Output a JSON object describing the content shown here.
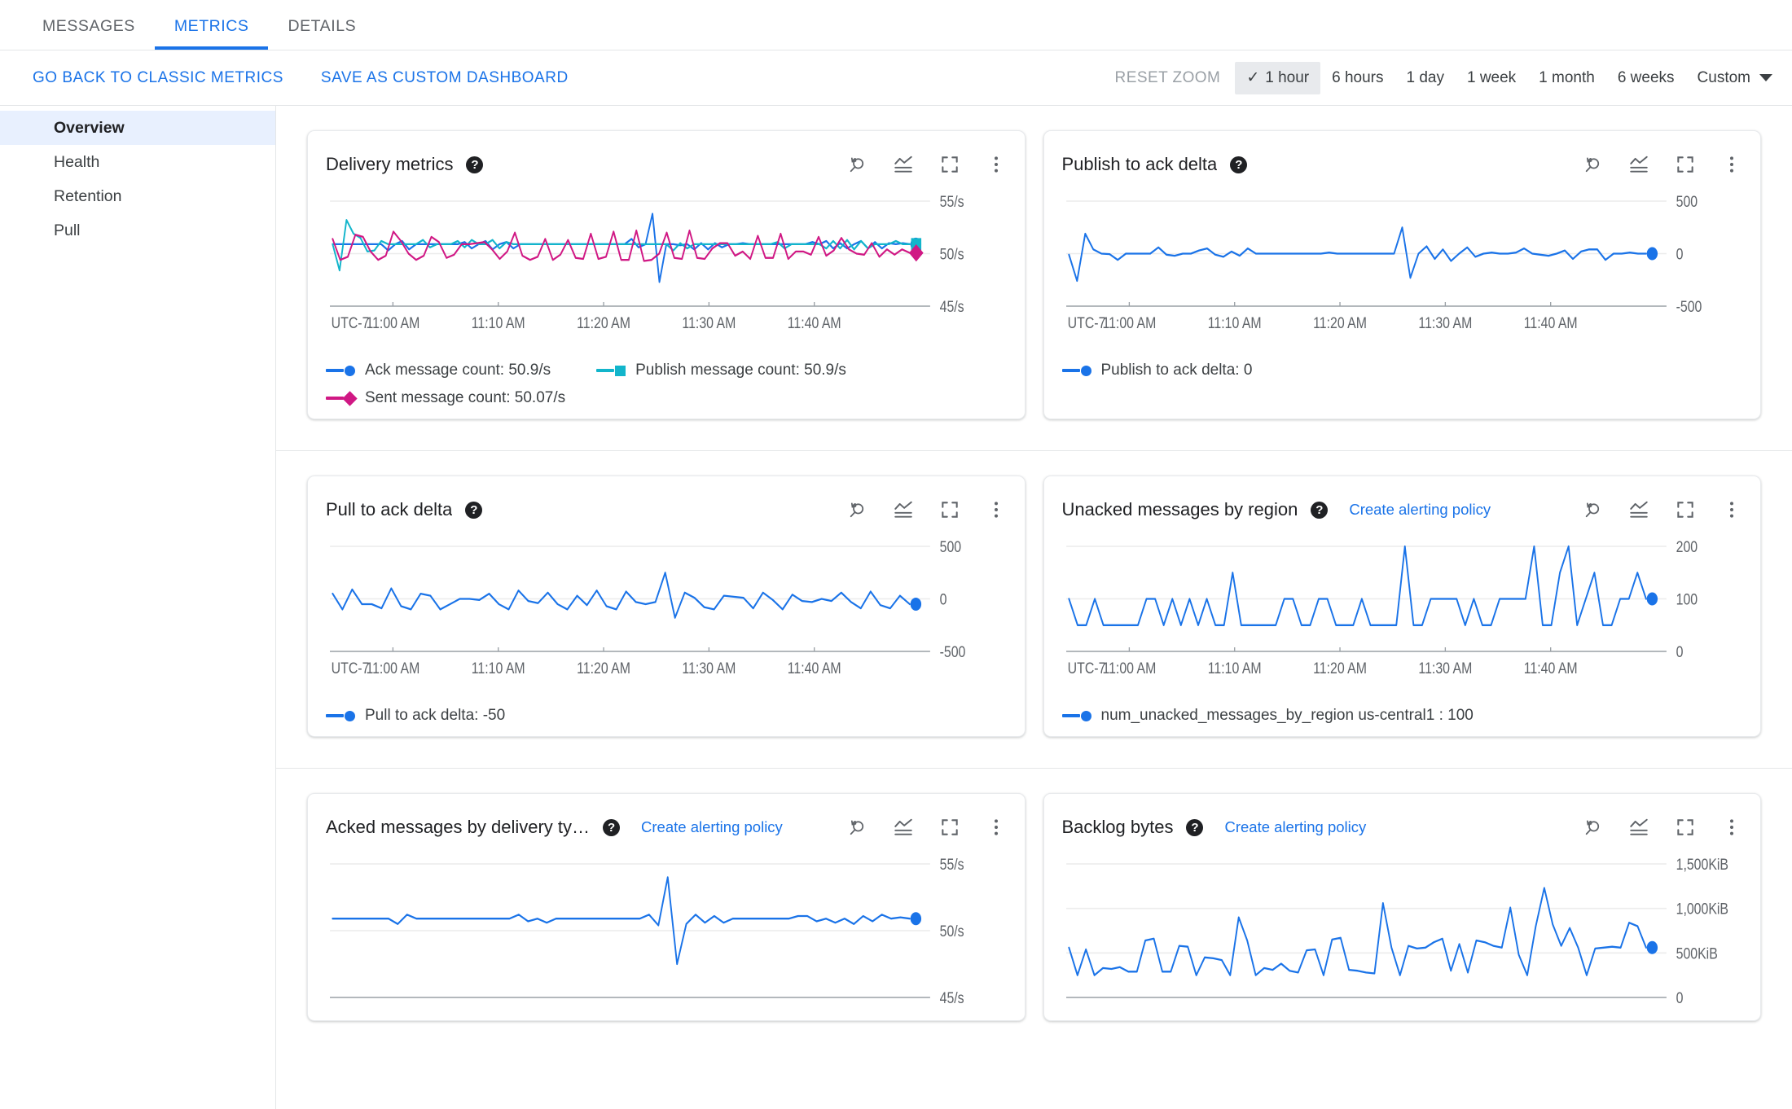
{
  "tabs": [
    {
      "label": "MESSAGES",
      "active": false
    },
    {
      "label": "METRICS",
      "active": true
    },
    {
      "label": "DETAILS",
      "active": false
    }
  ],
  "actionbar": {
    "go_back_label": "GO BACK TO CLASSIC METRICS",
    "save_dashboard_label": "SAVE AS CUSTOM DASHBOARD",
    "reset_zoom_label": "RESET ZOOM",
    "check_glyph": "✓",
    "ranges": [
      {
        "label": "1 hour",
        "selected": true
      },
      {
        "label": "6 hours",
        "selected": false
      },
      {
        "label": "1 day",
        "selected": false
      },
      {
        "label": "1 week",
        "selected": false
      },
      {
        "label": "1 month",
        "selected": false
      },
      {
        "label": "6 weeks",
        "selected": false
      },
      {
        "label": "Custom",
        "selected": false
      }
    ]
  },
  "sidebar": {
    "items": [
      {
        "label": "Overview",
        "active": true
      },
      {
        "label": "Health",
        "active": false
      },
      {
        "label": "Retention",
        "active": false
      },
      {
        "label": "Pull",
        "active": false
      }
    ]
  },
  "colors": {
    "blue": "#1a73e8",
    "teal": "#12b5cb",
    "pink": "#d01884",
    "accent_link": "#1a73e8",
    "axis_text": "#5f6368",
    "gridline": "#ececec",
    "selected_nav_bg": "#e8f0fe"
  },
  "icons": {
    "help": "?",
    "reset_zoom": "reset-zoom-icon",
    "chart_legend": "chart-lines-icon",
    "fullscreen": "fullscreen-icon",
    "more": "more-vert-icon"
  },
  "chart_data": [
    {
      "id": "delivery-metrics",
      "type": "line",
      "title": "Delivery metrics",
      "has_alert_link": false,
      "xlabel": "",
      "ylabel": "",
      "timezone_label": "UTC-7",
      "xtick_labels": [
        "11:00 AM",
        "11:10 AM",
        "11:20 AM",
        "11:30 AM",
        "11:40 AM"
      ],
      "ytick_labels": [
        "55/s",
        "50/s",
        "45/s"
      ],
      "ylim": [
        45,
        55
      ],
      "grid": true,
      "legend_position": "bottom",
      "series": [
        {
          "name": "Ack message count",
          "value_label": "Ack message count:  50.9/s",
          "color": "#1a73e8",
          "marker": "circle",
          "values": [
            50.9,
            50.9,
            50.9,
            50.9,
            50.9,
            50.9,
            50.9,
            50.9,
            50.3,
            50.9,
            51.2,
            50.4,
            50.9,
            50.9,
            50.9,
            50.9,
            50.9,
            50.9,
            50.9,
            51.1,
            50.5,
            50.9,
            51.2,
            50.4,
            50.9,
            51.1,
            50.5,
            50.9,
            50.9,
            50.9,
            50.9,
            50.9,
            50.9,
            50.9,
            50.9,
            50.9,
            50.9,
            50.9,
            50.9,
            50.9,
            50.9,
            50.9,
            50.9,
            51.4,
            50.6,
            50.9,
            53.8,
            47.3,
            50.9,
            50.9,
            50.8,
            50.9,
            50.4,
            51.0,
            50.4,
            51.0,
            50.6,
            50.9,
            50.9,
            51.0,
            50.9,
            50.9,
            50.9,
            50.9,
            50.9,
            50.9,
            50.9,
            50.9,
            50.9,
            51.1,
            50.9,
            51.2,
            50.5,
            51.0,
            50.5,
            50.9,
            51.2,
            50.5,
            51.1,
            50.5,
            51.0,
            50.9,
            51.0,
            50.9
          ]
        },
        {
          "name": "Publish message count",
          "value_label": "Publish message count:  50.9/s",
          "color": "#12b5cb",
          "marker": "square",
          "values": [
            50.9,
            48.4,
            53.2,
            51.9,
            51.5,
            50.2,
            50.3,
            51.2,
            50.9,
            50.9,
            50.9,
            50.9,
            50.9,
            51.3,
            50.6,
            50.9,
            50.9,
            50.9,
            51.2,
            50.6,
            51.3,
            50.9,
            50.9,
            51.3,
            50.5,
            51.1,
            50.9,
            50.9,
            50.9,
            50.9,
            50.9,
            50.9,
            50.9,
            50.9,
            50.9,
            50.9,
            50.9,
            50.9,
            50.9,
            50.9,
            50.9,
            50.9,
            50.9,
            50.9,
            50.9,
            50.9,
            50.9,
            50.9,
            50.9,
            50.3,
            51.0,
            50.5,
            50.9,
            50.9,
            50.9,
            50.9,
            50.9,
            50.9,
            50.9,
            50.9,
            50.9,
            50.9,
            50.9,
            50.9,
            51.1,
            50.5,
            50.9,
            50.9,
            50.9,
            50.9,
            50.9,
            50.5,
            51.2,
            50.5,
            51.3,
            50.4,
            51.2,
            50.5,
            50.9,
            50.9,
            50.9,
            51.2,
            50.9,
            50.9
          ]
        },
        {
          "name": "Sent message count",
          "value_label": "Sent message count:  50.07/s",
          "color": "#d01884",
          "marker": "diamond",
          "values": [
            51.4,
            49.4,
            49.7,
            51.8,
            51.6,
            50.2,
            49.4,
            49.8,
            52.1,
            51.2,
            50.0,
            49.4,
            49.8,
            51.6,
            51.1,
            49.6,
            49.9,
            50.9,
            50.9,
            51.0,
            51.1,
            50.4,
            49.5,
            50.2,
            52.0,
            49.8,
            49.4,
            49.7,
            51.4,
            49.4,
            49.9,
            51.3,
            49.6,
            49.5,
            51.9,
            49.5,
            49.7,
            52.1,
            49.4,
            49.4,
            52.2,
            49.3,
            49.4,
            50.0,
            52.0,
            49.6,
            49.5,
            52.2,
            49.6,
            49.5,
            50.5,
            51.0,
            51.0,
            49.8,
            50.2,
            49.5,
            51.7,
            49.6,
            49.6,
            51.9,
            49.5,
            50.2,
            50.2,
            49.9,
            51.6,
            49.8,
            50.3,
            51.5,
            50.4,
            50.0,
            49.9,
            51.0,
            49.7,
            50.4,
            49.9,
            50.4,
            50.07
          ]
        }
      ]
    },
    {
      "id": "publish-to-ack-delta",
      "type": "line",
      "title": "Publish to ack delta",
      "has_alert_link": false,
      "timezone_label": "UTC-7",
      "xtick_labels": [
        "11:00 AM",
        "11:10 AM",
        "11:20 AM",
        "11:30 AM",
        "11:40 AM"
      ],
      "ytick_labels": [
        "500",
        "0",
        "-500"
      ],
      "ylim": [
        -500,
        500
      ],
      "grid": true,
      "legend_position": "bottom",
      "series": [
        {
          "name": "Publish to ack delta",
          "value_label": "Publish to ack delta: 0",
          "color": "#1a73e8",
          "marker": "circle",
          "values": [
            -10,
            -260,
            190,
            40,
            0,
            -5,
            -60,
            0,
            0,
            0,
            0,
            60,
            -10,
            -20,
            0,
            0,
            30,
            50,
            -10,
            -30,
            20,
            -20,
            50,
            0,
            0,
            0,
            0,
            0,
            0,
            0,
            0,
            0,
            10,
            0,
            0,
            0,
            0,
            0,
            0,
            0,
            0,
            250,
            -230,
            0,
            70,
            -50,
            40,
            -70,
            0,
            60,
            -30,
            0,
            10,
            0,
            0,
            10,
            50,
            0,
            -10,
            -20,
            0,
            30,
            -50,
            20,
            40,
            40,
            -60,
            0,
            0,
            10,
            0,
            0
          ]
        }
      ]
    },
    {
      "id": "pull-to-ack-delta",
      "type": "line",
      "title": "Pull to ack delta",
      "has_alert_link": false,
      "timezone_label": "UTC-7",
      "xtick_labels": [
        "11:00 AM",
        "11:10 AM",
        "11:20 AM",
        "11:30 AM",
        "11:40 AM"
      ],
      "ytick_labels": [
        "500",
        "0",
        "-500"
      ],
      "ylim": [
        -500,
        500
      ],
      "grid": true,
      "legend_position": "bottom",
      "series": [
        {
          "name": "Pull to ack delta",
          "value_label": "Pull to ack delta: -50",
          "color": "#1a73e8",
          "marker": "circle",
          "values": [
            50,
            -100,
            90,
            -50,
            -50,
            -90,
            100,
            -70,
            -100,
            50,
            30,
            -100,
            -50,
            0,
            0,
            -10,
            50,
            -50,
            -100,
            80,
            -20,
            -40,
            60,
            -50,
            -100,
            30,
            -60,
            80,
            -70,
            -100,
            70,
            -30,
            -50,
            -30,
            250,
            -180,
            60,
            10,
            -80,
            -100,
            30,
            20,
            10,
            -90,
            60,
            -10,
            -100,
            40,
            -20,
            -30,
            0,
            -20,
            60,
            -30,
            -90,
            70,
            -60,
            -90,
            30,
            -50
          ]
        }
      ]
    },
    {
      "id": "unacked-messages-by-region",
      "type": "line",
      "title": "Unacked messages by region",
      "has_alert_link": true,
      "alert_link_label": "Create alerting policy",
      "timezone_label": "UTC-7",
      "xtick_labels": [
        "11:00 AM",
        "11:10 AM",
        "11:20 AM",
        "11:30 AM",
        "11:40 AM"
      ],
      "ytick_labels": [
        "200",
        "100",
        "0"
      ],
      "ylim": [
        0,
        200
      ],
      "grid": true,
      "legend_position": "bottom",
      "series": [
        {
          "name": "num_unacked_messages_by_region us-central1",
          "value_label": "num_unacked_messages_by_region us-central1 :  100",
          "color": "#1a73e8",
          "marker": "circle",
          "values": [
            100,
            50,
            50,
            100,
            50,
            50,
            50,
            50,
            50,
            100,
            100,
            50,
            100,
            50,
            100,
            50,
            100,
            50,
            50,
            150,
            50,
            50,
            50,
            50,
            50,
            100,
            100,
            50,
            50,
            100,
            100,
            50,
            50,
            50,
            100,
            50,
            50,
            50,
            50,
            200,
            50,
            50,
            100,
            100,
            100,
            100,
            50,
            100,
            50,
            50,
            100,
            100,
            100,
            100,
            200,
            50,
            50,
            150,
            200,
            50,
            100,
            150,
            50,
            50,
            100,
            100,
            150,
            100
          ]
        }
      ]
    },
    {
      "id": "acked-messages-by-delivery-type",
      "type": "line",
      "title": "Acked messages by delivery ty…",
      "has_alert_link": true,
      "alert_link_label": "Create alerting policy",
      "timezone_label": "UTC-7",
      "xtick_labels": [],
      "ytick_labels": [
        "55/s",
        "50/s",
        "45/s"
      ],
      "ylim": [
        45,
        55
      ],
      "grid": true,
      "legend_position": "bottom",
      "series": [
        {
          "name": "Acked messages by delivery type",
          "value_label": "",
          "color": "#1a73e8",
          "marker": "circle",
          "values": [
            50.9,
            50.9,
            50.9,
            50.9,
            50.9,
            50.9,
            50.9,
            50.5,
            51.2,
            50.9,
            50.9,
            50.9,
            50.9,
            50.9,
            50.9,
            50.9,
            50.9,
            50.9,
            50.9,
            50.9,
            51.2,
            50.7,
            50.9,
            50.6,
            50.9,
            50.9,
            50.9,
            50.9,
            50.9,
            50.9,
            50.9,
            50.9,
            50.9,
            50.9,
            51.2,
            50.4,
            54.0,
            47.5,
            50.5,
            51.2,
            50.6,
            51.1,
            50.6,
            50.9,
            50.9,
            50.9,
            50.9,
            50.9,
            50.9,
            50.9,
            51.1,
            51.1,
            50.7,
            50.9,
            50.6,
            50.9,
            50.5,
            51.1,
            50.7,
            51.2,
            50.9,
            51.0,
            50.9
          ]
        }
      ]
    },
    {
      "id": "backlog-bytes",
      "type": "line",
      "title": "Backlog bytes",
      "has_alert_link": true,
      "alert_link_label": "Create alerting policy",
      "timezone_label": "UTC-7",
      "xtick_labels": [],
      "ytick_labels": [
        "1,500KiB",
        "1,000KiB",
        "500KiB",
        "0"
      ],
      "ylim": [
        0,
        1500
      ],
      "grid": true,
      "legend_position": "bottom",
      "series": [
        {
          "name": "Backlog bytes",
          "value_label": "",
          "color": "#1a73e8",
          "marker": "circle",
          "values": [
            560,
            250,
            540,
            250,
            330,
            320,
            340,
            290,
            290,
            640,
            660,
            290,
            290,
            580,
            570,
            250,
            450,
            440,
            420,
            250,
            900,
            640,
            250,
            330,
            310,
            380,
            300,
            280,
            530,
            540,
            250,
            650,
            670,
            310,
            300,
            280,
            270,
            1060,
            560,
            250,
            580,
            550,
            560,
            620,
            660,
            300,
            600,
            280,
            640,
            620,
            580,
            560,
            1010,
            480,
            250,
            800,
            1230,
            820,
            580,
            780,
            560,
            250,
            550,
            560,
            570,
            560,
            840,
            800,
            560
          ]
        }
      ]
    }
  ]
}
